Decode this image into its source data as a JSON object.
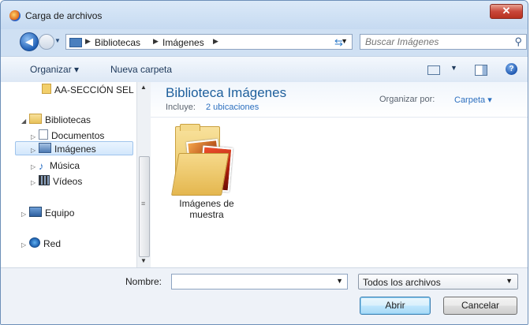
{
  "window": {
    "title": "Carga de archivos",
    "close_label": "✕"
  },
  "address": {
    "segments": [
      "Bibliotecas",
      "Imágenes"
    ]
  },
  "search": {
    "placeholder": "Buscar Imágenes"
  },
  "toolbar": {
    "organize_label": "Organizar ▾",
    "new_folder_label": "Nueva carpeta",
    "help_label": "?"
  },
  "sidebar": {
    "items": [
      {
        "label": "AA-SECCIÓN SEL"
      },
      {
        "label": "Bibliotecas"
      },
      {
        "label": "Documentos"
      },
      {
        "label": "Imágenes"
      },
      {
        "label": "Música"
      },
      {
        "label": "Vídeos"
      },
      {
        "label": "Equipo"
      },
      {
        "label": "Red"
      }
    ]
  },
  "library": {
    "title": "Biblioteca Imágenes",
    "includes_label": "Incluye:",
    "includes_link": "2 ubicaciones",
    "arrange_label": "Organizar por:",
    "arrange_value": "Carpeta ▾"
  },
  "files": [
    {
      "name": "Imágenes de muestra"
    }
  ],
  "footer": {
    "name_label": "Nombre:",
    "name_value": "",
    "file_type": "Todos los archivos",
    "open_label": "Abrir",
    "cancel_label": "Cancelar"
  }
}
